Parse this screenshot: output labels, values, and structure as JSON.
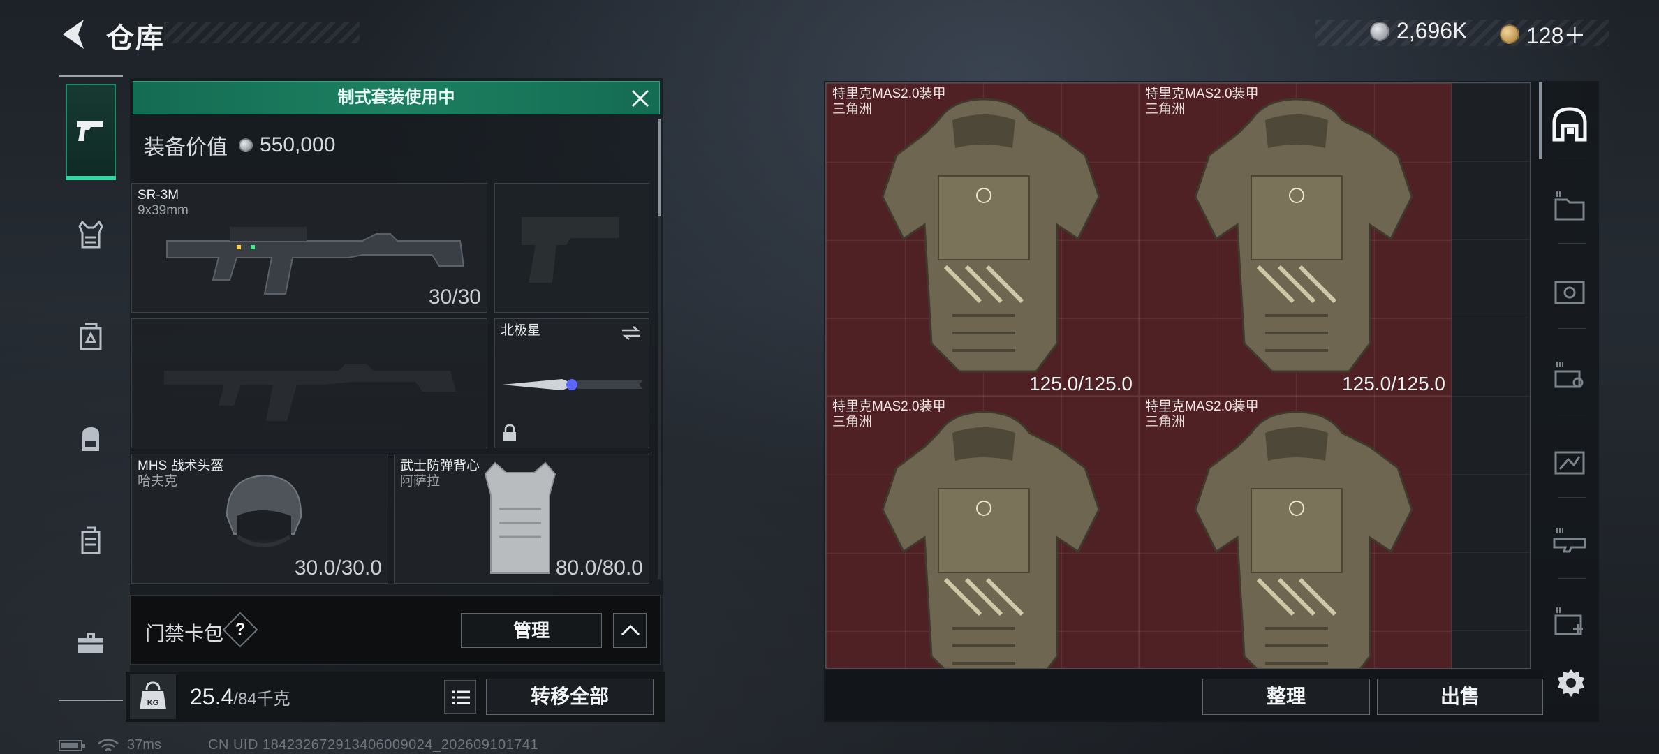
{
  "header": {
    "title": "仓库",
    "currency": [
      {
        "value": "2,696K",
        "icon": "silver-coin-icon"
      },
      {
        "value": "128＋",
        "icon": "gold-coin-icon"
      }
    ]
  },
  "loadout": {
    "banner": "制式套装使用中",
    "value_label": "装备价值",
    "value": "550,000",
    "primary_weapon": {
      "name": "SR-3M",
      "caliber": "9x39mm",
      "ammo": "30/30"
    },
    "melee": {
      "name": "北极星"
    },
    "helmet": {
      "name": "MHS 战术头盔",
      "sub": "哈夫克",
      "durability": "30.0/30.0"
    },
    "armor": {
      "name": "武士防弹背心",
      "sub": "阿萨拉",
      "durability": "80.0/80.0"
    },
    "keycard_label": "门禁卡包",
    "help_label": "?",
    "manage_label": "管理",
    "weight": "25.4",
    "weight_limit": "/84千克",
    "transfer_label": "转移全部"
  },
  "storage": {
    "items": [
      {
        "name": "特里克MAS2.0装甲",
        "sub": "三角洲",
        "durability": "125.0/125.0"
      },
      {
        "name": "特里克MAS2.0装甲",
        "sub": "三角洲",
        "durability": "125.0/125.0"
      },
      {
        "name": "特里克MAS2.0装甲",
        "sub": "三角洲",
        "durability": ""
      },
      {
        "name": "特里克MAS2.0装甲",
        "sub": "三角洲",
        "durability": ""
      }
    ],
    "sort_label": "整理",
    "sell_label": "出售"
  },
  "footer": {
    "ping": "37ms",
    "uid": "CN UID 1842326729134060090​24_202609101741"
  },
  "colors": {
    "accent_green": "#1d7f60",
    "item_red": "#702024"
  }
}
